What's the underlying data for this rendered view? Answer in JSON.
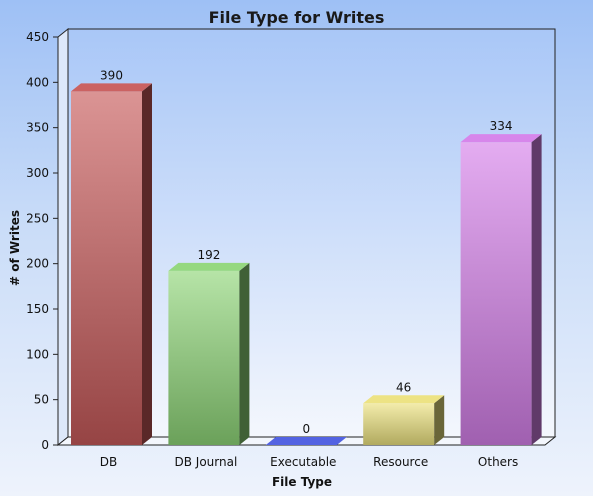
{
  "chart_data": {
    "type": "bar",
    "title": "File Type for Writes",
    "xlabel": "File Type",
    "ylabel": "# of Writes",
    "categories": [
      "DB",
      "DB Journal",
      "Executable",
      "Resource",
      "Others"
    ],
    "values": [
      390,
      192,
      0,
      46,
      334
    ],
    "colors": [
      "#c85a5a",
      "#8fd678",
      "#4a5be0",
      "#ece27e",
      "#d580ea"
    ],
    "ylim": [
      0,
      450
    ],
    "yticks": [
      0,
      50,
      100,
      150,
      200,
      250,
      300,
      350,
      400,
      450
    ],
    "grid": false,
    "legend": "none"
  }
}
